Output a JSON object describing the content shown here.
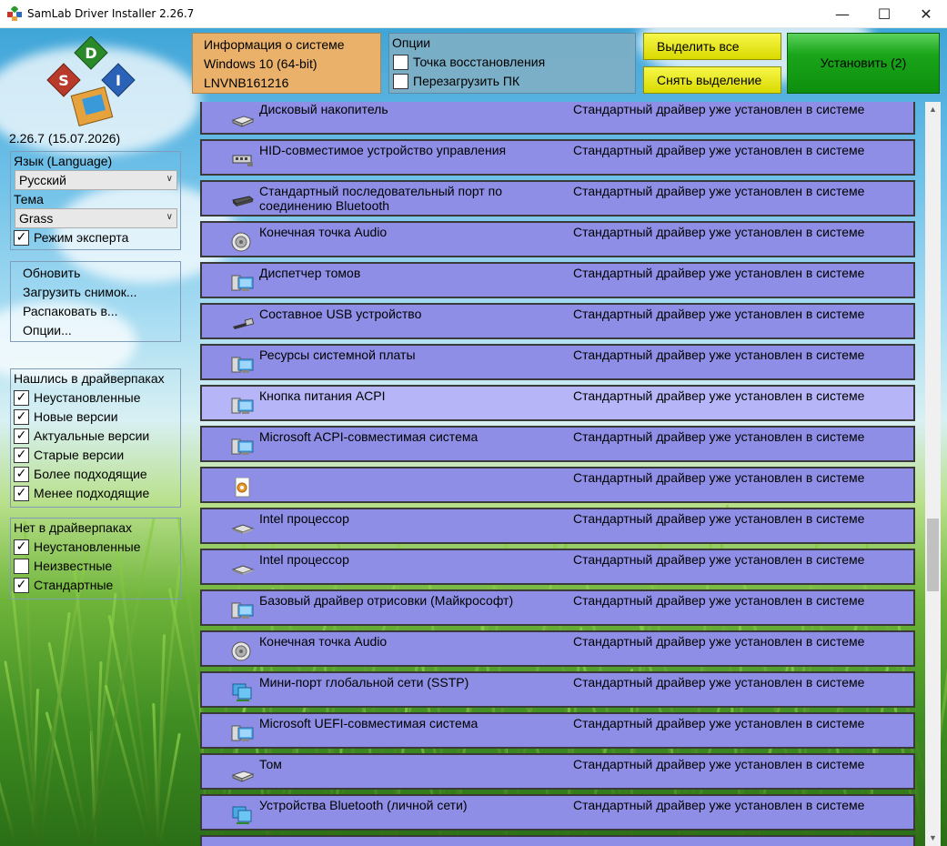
{
  "window": {
    "title": "SamLab Driver Installer 2.26.7",
    "minimize": "—",
    "maximize": "☐",
    "close": "✕"
  },
  "version": "2.26.7 (15.07.2026)",
  "settings": {
    "language_label": "Язык (Language)",
    "language_value": "Русский",
    "theme_label": "Тема",
    "theme_value": "Grass",
    "expert_mode_label": "Режим эксперта",
    "expert_mode_checked": true
  },
  "menu": [
    "Обновить",
    "Загрузить снимок...",
    "Распаковать в...",
    "Опции..."
  ],
  "found": {
    "title": "Нашлись в драйверпаках",
    "items": [
      {
        "label": "Неустановленные",
        "checked": true
      },
      {
        "label": "Новые версии",
        "checked": true
      },
      {
        "label": "Актуальные версии",
        "checked": true
      },
      {
        "label": "Старые версии",
        "checked": true
      },
      {
        "label": "Более подходящие",
        "checked": true
      },
      {
        "label": "Менее подходящие",
        "checked": true
      }
    ]
  },
  "notfound": {
    "title": "Нет в драйверпаках",
    "items": [
      {
        "label": "Неустановленные",
        "checked": true
      },
      {
        "label": "Неизвестные",
        "checked": false
      },
      {
        "label": "Стандартные",
        "checked": true
      }
    ]
  },
  "sysinfo": {
    "title": "Информация о системе",
    "os": "Windows 10 (64-bit)",
    "host": "LNVNB161216"
  },
  "options": {
    "title": "Опции",
    "restore_point": "Точка восстановления",
    "reboot": "Перезагрузить ПК"
  },
  "buttons": {
    "select_all": "Выделить все",
    "deselect": "Снять выделение",
    "install": "Установить (2)"
  },
  "devices": [
    {
      "name": "Дисковый накопитель",
      "status": "Стандартный драйвер уже установлен в системе",
      "icon": "disk-icon"
    },
    {
      "name": "HID-совместимое устройство управления",
      "status": "Стандартный драйвер уже установлен в системе",
      "icon": "usb-icon"
    },
    {
      "name": "Стандартный последовательный порт по соединению Bluetooth",
      "status": "Стандартный драйвер уже установлен в системе",
      "icon": "port-icon"
    },
    {
      "name": "Конечная точка Audio",
      "status": "Стандартный драйвер уже установлен в системе",
      "icon": "speaker-icon"
    },
    {
      "name": "Диспетчер томов",
      "status": "Стандартный драйвер уже установлен в системе",
      "icon": "computer-icon"
    },
    {
      "name": "Составное USB устройство",
      "status": "Стандартный драйвер уже установлен в системе",
      "icon": "usb-plug-icon"
    },
    {
      "name": "Ресурсы системной платы",
      "status": "Стандартный драйвер уже установлен в системе",
      "icon": "computer-icon"
    },
    {
      "name": "Кнопка питания ACPI",
      "status": "Стандартный драйвер уже установлен в системе",
      "icon": "computer-icon",
      "highlighted": true
    },
    {
      "name": "Microsoft ACPI-совместимая система",
      "status": "Стандартный драйвер уже установлен в системе",
      "icon": "computer-icon"
    },
    {
      "name": "",
      "status": "Стандартный драйвер уже установлен в системе",
      "icon": "gear-file-icon"
    },
    {
      "name": "Intel процессор",
      "status": "Стандартный драйвер уже установлен в системе",
      "icon": "chip-icon"
    },
    {
      "name": "Intel процессор",
      "status": "Стандартный драйвер уже установлен в системе",
      "icon": "chip-icon"
    },
    {
      "name": "Базовый драйвер отрисовки (Майкрософт)",
      "status": "Стандартный драйвер уже установлен в системе",
      "icon": "computer-icon"
    },
    {
      "name": "Конечная точка Audio",
      "status": "Стандартный драйвер уже установлен в системе",
      "icon": "speaker-icon"
    },
    {
      "name": "Мини-порт глобальной сети (SSTP)",
      "status": "Стандартный драйвер уже установлен в системе",
      "icon": "network-icon"
    },
    {
      "name": "Microsoft UEFI-совместимая система",
      "status": "Стандартный драйвер уже установлен в системе",
      "icon": "computer-icon"
    },
    {
      "name": "Том",
      "status": "Стандартный драйвер уже установлен в системе",
      "icon": "disk-icon"
    },
    {
      "name": "Устройства Bluetooth (личной сети)",
      "status": "Стандартный драйвер уже установлен в системе",
      "icon": "network-icon"
    },
    {
      "name": "",
      "status": "",
      "icon": ""
    }
  ],
  "colors": {
    "row": "#8e8ee6",
    "row_highlight": "#b5b5f7",
    "sysinfo": "#e9b16a",
    "install": "#1aa51a",
    "yellow": "#e8e800"
  }
}
